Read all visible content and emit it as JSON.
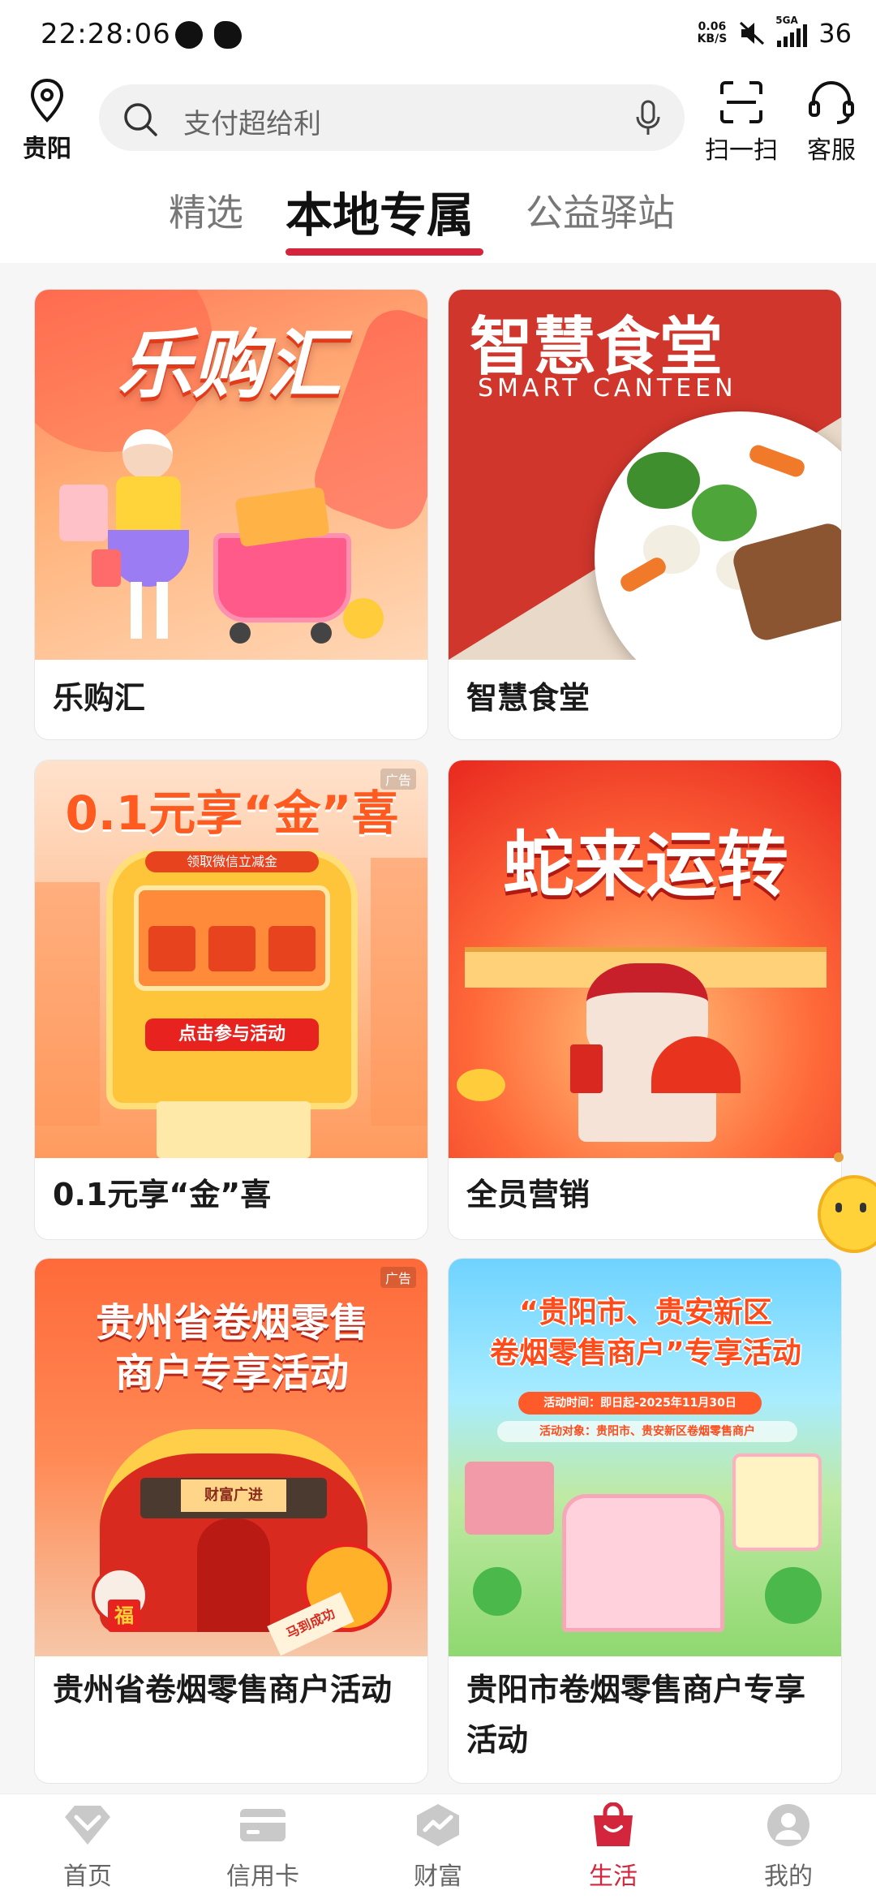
{
  "status_bar": {
    "time": "22:28:06",
    "net_speed_value": "0.06",
    "net_speed_unit": "KB/S",
    "network": "5GA",
    "battery": "36"
  },
  "header": {
    "location": "贵阳",
    "search_placeholder": "支付超给利",
    "scan_label": "扫一扫",
    "service_label": "客服"
  },
  "tabs": [
    {
      "label": "精选",
      "active": false
    },
    {
      "label": "本地专属",
      "active": true
    },
    {
      "label": "公益驿站",
      "active": false
    }
  ],
  "cards": [
    {
      "title": "乐购汇",
      "banner_text": "乐购汇"
    },
    {
      "title": "智慧食堂",
      "banner_text": "智慧食堂",
      "banner_subtext": "SMART CANTEEN"
    },
    {
      "title": "0.1元享“金”喜",
      "banner_text": "0.1元享“金”喜",
      "ad_label": "广告",
      "machine_label": "领取微信立减金",
      "machine_button": "点击参与活动"
    },
    {
      "title": "全员营销",
      "banner_text": "蛇来运转"
    },
    {
      "title": "贵州省卷烟零售商户活动",
      "banner_text_line1": "贵州省卷烟零售",
      "banner_text_line2": "商户专享活动",
      "ad_label": "广告",
      "sign_text": "财富广进",
      "fu_text": "福",
      "scroll_text": "马到成功"
    },
    {
      "title": "贵阳市卷烟零售商户专享活动",
      "banner_text_line1": "“贵阳市、贵安新区",
      "banner_text_line2": "卷烟零售商户”专享活动",
      "time_text": "活动时间：即日起-2025年11月30日",
      "target_text": "活动对象：贵阳市、贵安新区卷烟零售商户"
    }
  ],
  "bottom_nav": [
    {
      "label": "首页",
      "active": false
    },
    {
      "label": "信用卡",
      "active": false
    },
    {
      "label": "财富",
      "active": false
    },
    {
      "label": "生活",
      "active": true
    },
    {
      "label": "我的",
      "active": false
    }
  ],
  "colors": {
    "accent": "#d3253b"
  }
}
